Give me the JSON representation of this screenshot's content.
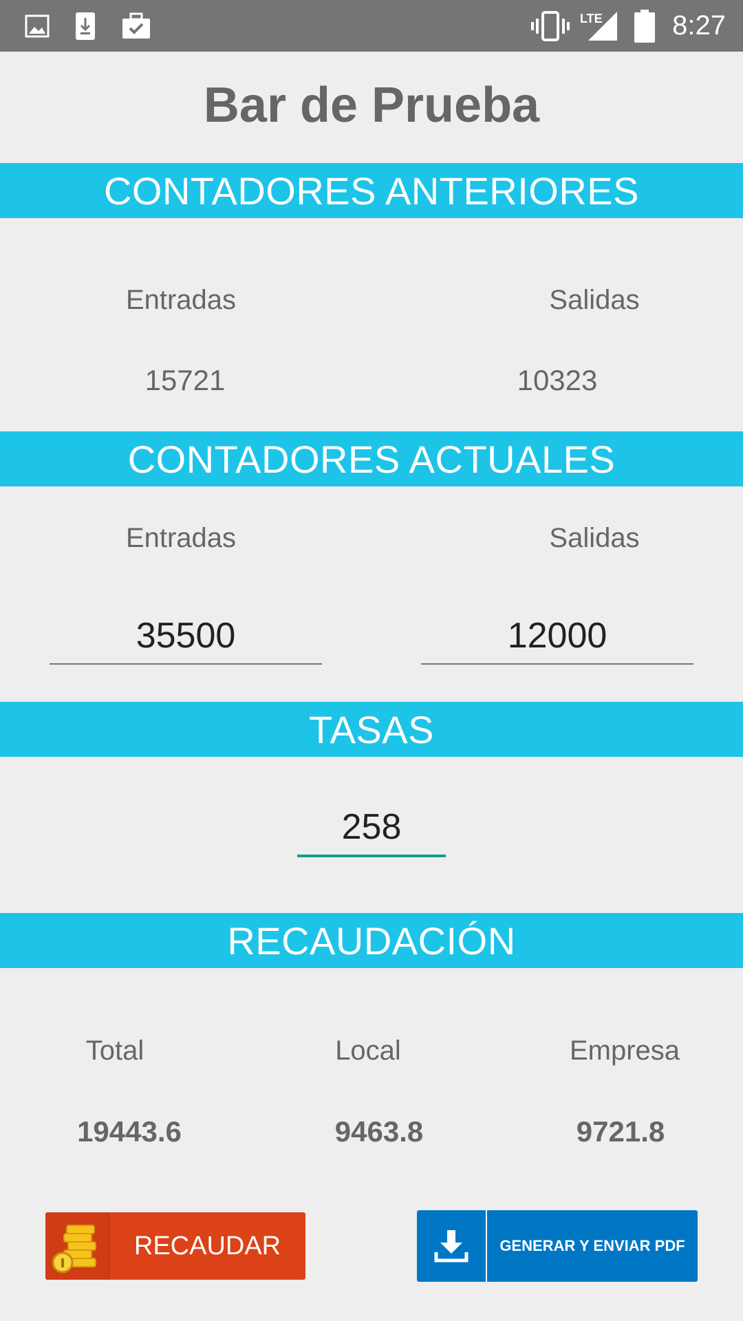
{
  "status_bar": {
    "time": "8:27",
    "network_label": "LTE",
    "left_icons": [
      "image-icon",
      "download-icon",
      "briefcase-check-icon"
    ],
    "right_icons": [
      "vibrate-icon",
      "signal-icon",
      "battery-icon"
    ]
  },
  "app": {
    "title": "Bar de Prueba"
  },
  "anteriores": {
    "header": "CONTADORES ANTERIORES",
    "entradas_label": "Entradas",
    "salidas_label": "Salidas",
    "entradas_value": "15721",
    "salidas_value": "10323"
  },
  "actuales": {
    "header": "CONTADORES ACTUALES",
    "entradas_label": "Entradas",
    "salidas_label": "Salidas",
    "entradas_value": "35500",
    "salidas_value": "12000"
  },
  "tasas": {
    "header": "TASAS",
    "value": "258"
  },
  "recaudacion": {
    "header": "RECAUDACIÓN",
    "total_label": "Total",
    "local_label": "Local",
    "empresa_label": "Empresa",
    "total_value": "19443.6",
    "local_value": "9463.8",
    "empresa_value": "9721.8"
  },
  "buttons": {
    "recaudar_label": "RECAUDAR",
    "recaudar_icon": "coins-icon",
    "pdf_label": "GENERAR Y ENVIAR PDF",
    "pdf_icon": "download-icon"
  },
  "colors": {
    "band": "#1ec3e8",
    "recaudar_button": "#dc4218",
    "pdf_button": "#0077c5",
    "focus_underline": "#119e8f"
  }
}
